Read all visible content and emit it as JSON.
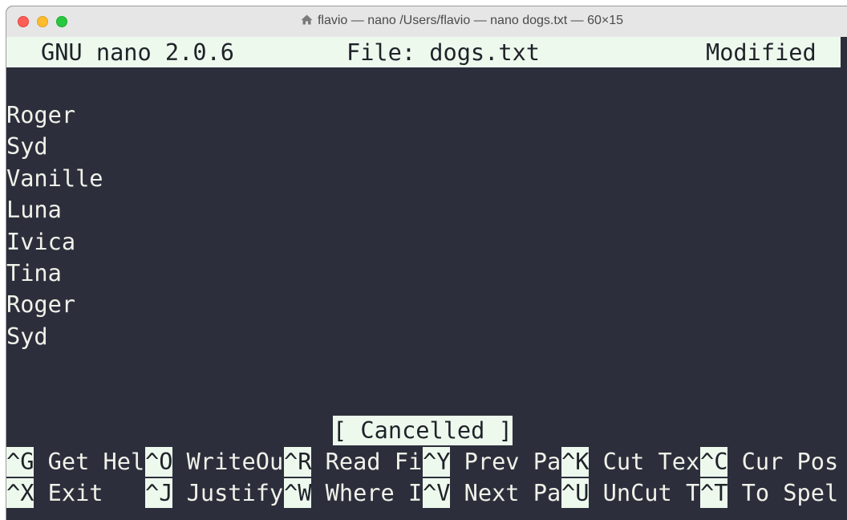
{
  "window": {
    "title": "flavio — nano /Users/flavio — nano dogs.txt — 60×15"
  },
  "header": {
    "app_version": "GNU nano 2.0.6",
    "file": "File: dogs.txt",
    "status": "Modified"
  },
  "file_lines": [
    "Roger",
    "Syd",
    "Vanille",
    "Luna",
    "Ivica",
    "Tina",
    "Roger",
    "Syd"
  ],
  "message": "[ Cancelled ]",
  "shortcuts_row1": [
    {
      "key": "^G",
      "label": " Get Hel"
    },
    {
      "key": "^O",
      "label": " WriteOu"
    },
    {
      "key": "^R",
      "label": " Read Fi"
    },
    {
      "key": "^Y",
      "label": " Prev Pa"
    },
    {
      "key": "^K",
      "label": " Cut Tex"
    },
    {
      "key": "^C",
      "label": " Cur Pos"
    }
  ],
  "shortcuts_row2": [
    {
      "key": "^X",
      "label": " Exit"
    },
    {
      "key": "^J",
      "label": " Justify"
    },
    {
      "key": "^W",
      "label": " Where I"
    },
    {
      "key": "^V",
      "label": " Next Pa"
    },
    {
      "key": "^U",
      "label": " UnCut T"
    },
    {
      "key": "^T",
      "label": " To Spel"
    }
  ]
}
